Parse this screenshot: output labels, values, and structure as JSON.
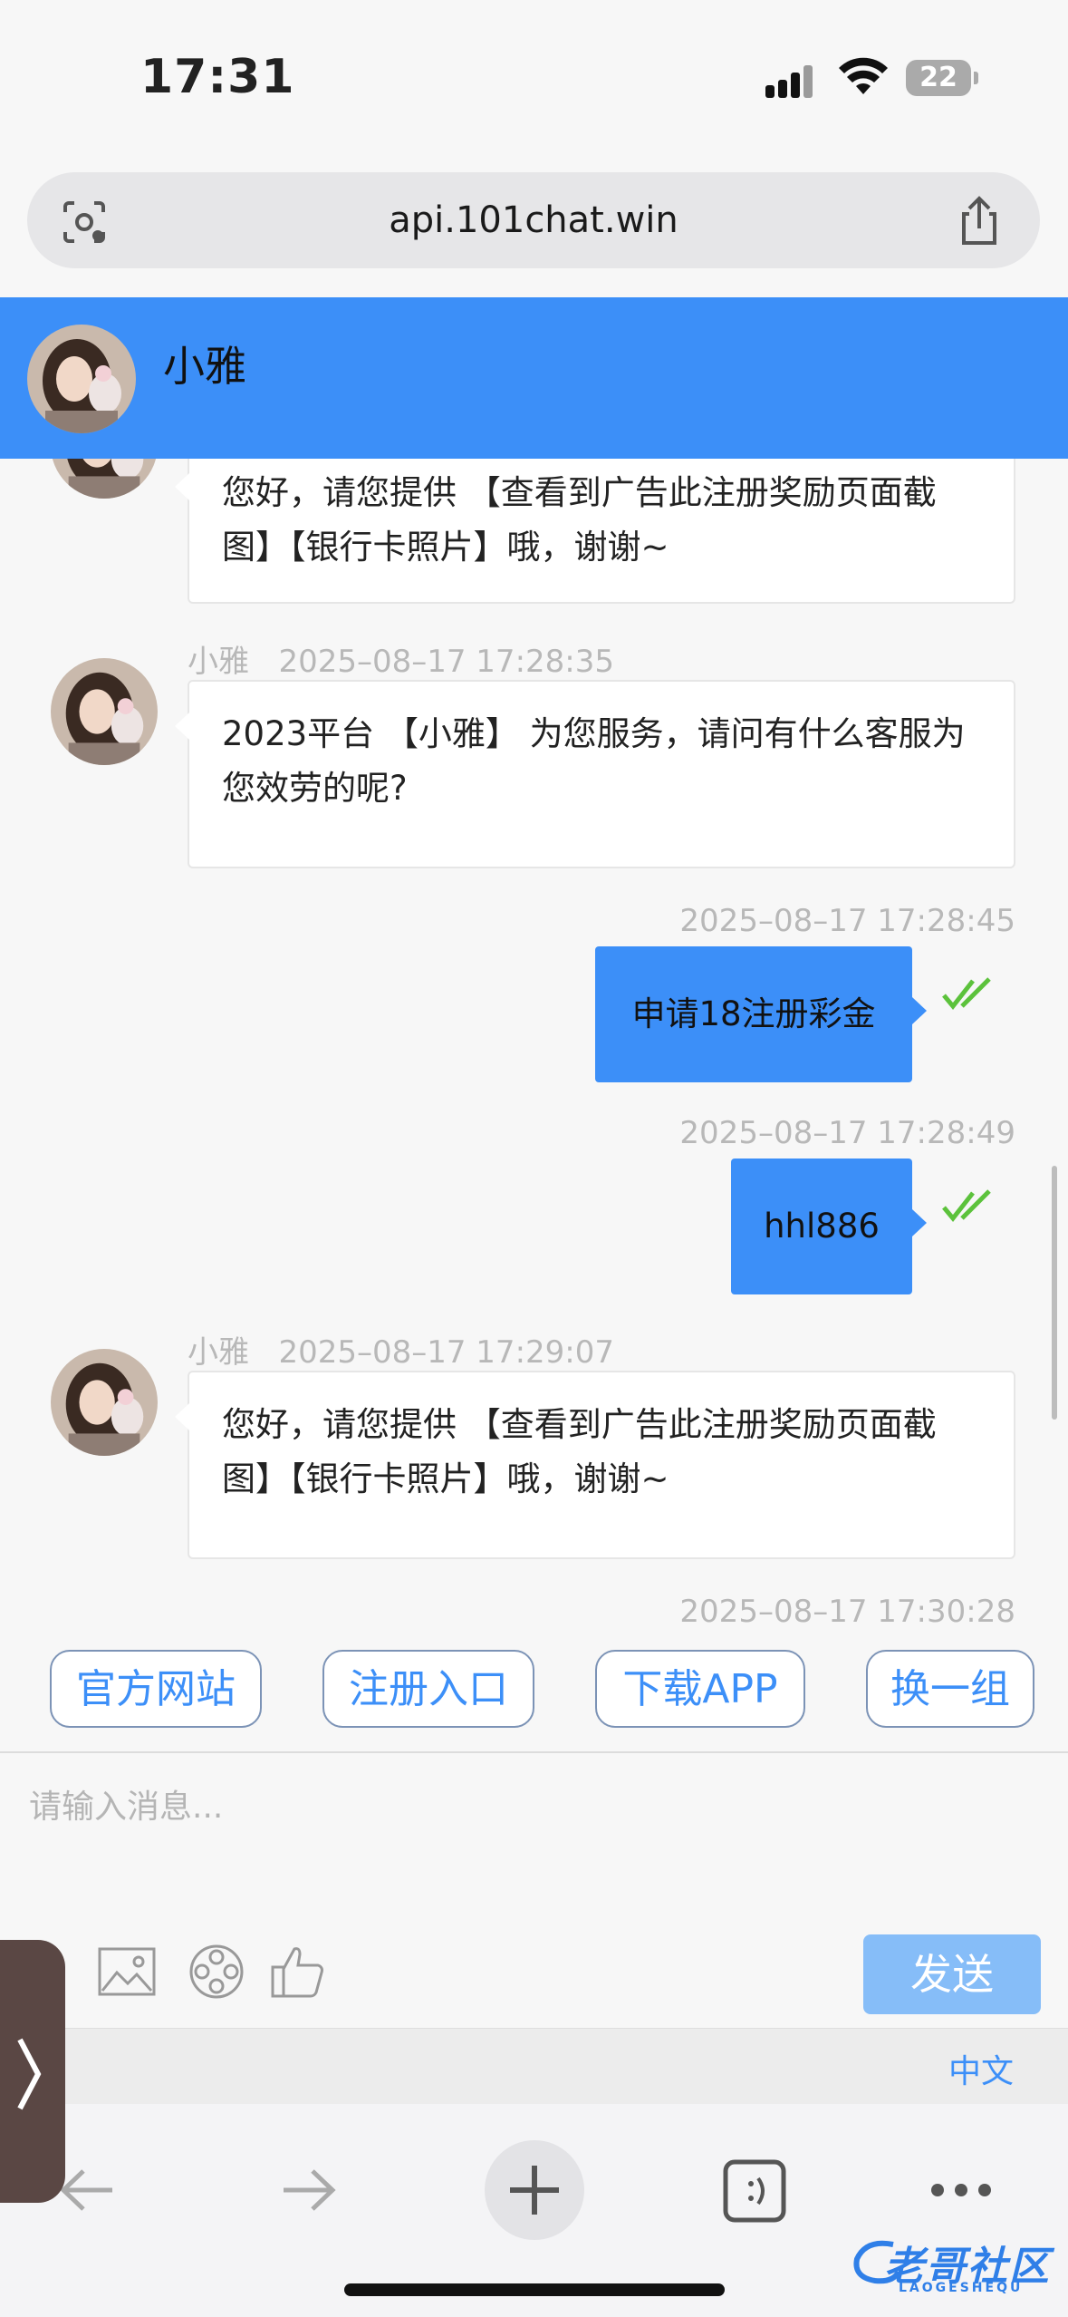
{
  "status_bar": {
    "time": "17:31",
    "battery": "22"
  },
  "browser": {
    "url": "api.101chat.win"
  },
  "header": {
    "agent_name": "小雅"
  },
  "messages": [
    {
      "dir": "in",
      "text": "您好，请您提供 【查看到广告此注册奖励页面截图】【银行卡照片】哦，谢谢~"
    },
    {
      "dir": "in",
      "sender": "小雅",
      "time": "2025–08–17 17:28:35",
      "text": "2023平台 【小雅】 为您服务，请问有什么客服为您效劳的呢?"
    },
    {
      "dir": "out",
      "time": "2025–08–17 17:28:45",
      "text": "申请18注册彩金"
    },
    {
      "dir": "out",
      "time": "2025–08–17 17:28:49",
      "text": "hhl886"
    },
    {
      "dir": "in",
      "sender": "小雅",
      "time": "2025–08–17 17:29:07",
      "text": "您好，请您提供 【查看到广告此注册奖励页面截图】【银行卡照片】哦，谢谢~"
    },
    {
      "dir": "out",
      "time": "2025–08–17 17:30:28"
    }
  ],
  "quick_buttons": [
    "官方网站",
    "注册入口",
    "下载APP",
    "换一组"
  ],
  "composer": {
    "placeholder": "请输入消息...",
    "send_label": "发送"
  },
  "language": "中文",
  "watermark": {
    "text": "老哥社区",
    "sub": "LAOGESHEQU"
  },
  "colors": {
    "accent": "#3c8ff8",
    "send_button": "#86bdf8",
    "check": "#5cc23c"
  }
}
